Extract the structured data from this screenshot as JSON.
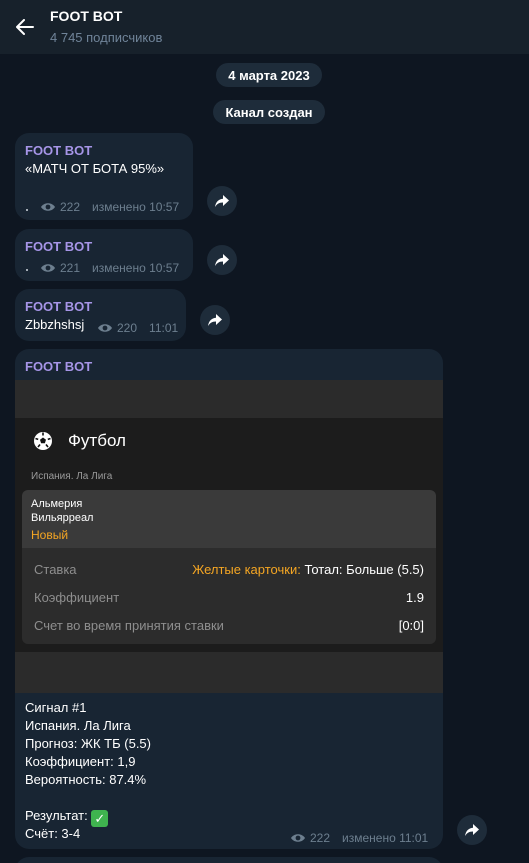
{
  "header": {
    "title": "FOOT BOT",
    "subscribers": "4 745 подписчиков"
  },
  "pills": {
    "date": "4 марта 2023",
    "created": "Канал создан"
  },
  "messages": [
    {
      "sender": "FOOT BOT",
      "text": "«МАТЧ ОТ БОТА 95%»",
      "dot": "·",
      "views": "222",
      "time": "изменено 10:57"
    },
    {
      "sender": "FOOT BOT",
      "text": "",
      "dot": "·",
      "views": "221",
      "time": "изменено 10:57"
    },
    {
      "sender": "FOOT BOT",
      "text": "Zbbzhshsj",
      "views": "220",
      "time": "11:01"
    }
  ],
  "photo_post": {
    "sender": "FOOT BOT",
    "sport": "Футбол",
    "league": "Испания. Ла Лига",
    "team_home": "Альмерия",
    "team_away": "Вильярреал",
    "status": "Новый",
    "rows": [
      {
        "label": "Ставка",
        "value_accent": "Желтые карточки:",
        "value": " Тотал: Больше (5.5)"
      },
      {
        "label": "Коэффициент",
        "value": "1.9"
      },
      {
        "label": "Счет во время принятия ставки",
        "value": "[0:0]"
      }
    ],
    "caption": {
      "line1": "Сигнал #1",
      "line2": "Испания. Ла Лига",
      "line3": "Прогноз: ЖК ТБ (5.5)",
      "line4": "Коэффициент: 1,9",
      "line5": "Вероятность: 87.4%",
      "result_label": "Результат:",
      "result_icon": "✓",
      "score": "Счёт: 3-4"
    },
    "views": "222",
    "time": "изменено 11:01"
  },
  "colors": {
    "background": "#0e1621",
    "header": "#17212b",
    "bubble": "#182533",
    "sender": "#a695e7",
    "accent_orange": "#f5a623"
  }
}
